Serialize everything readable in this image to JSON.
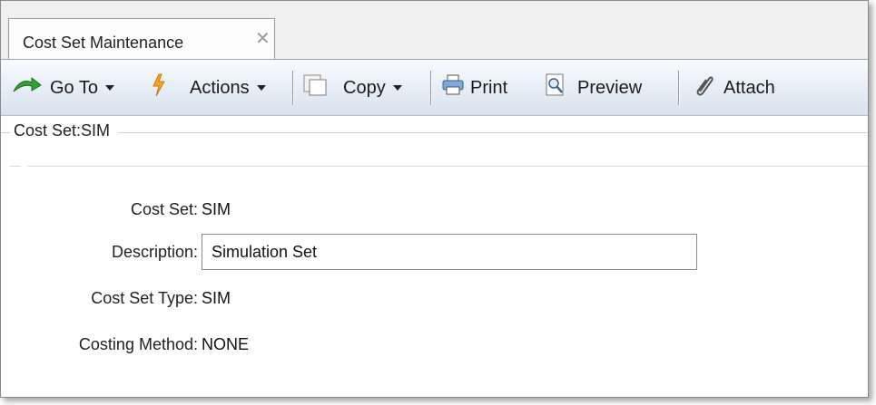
{
  "tab": {
    "title": "Cost Set Maintenance",
    "close_glyph": "✕"
  },
  "toolbar": {
    "goto_label": "Go To",
    "actions_label": "Actions",
    "copy_label": "Copy",
    "print_label": "Print",
    "preview_label": "Preview",
    "attach_label": "Attach",
    "icons": {
      "goto": "green-arrow-icon",
      "actions": "lightning-icon",
      "copy": "copy-icon",
      "print": "printer-icon",
      "preview": "preview-icon",
      "attach": "paperclip-icon"
    }
  },
  "section": {
    "title": "Cost Set:SIM"
  },
  "form": {
    "cost_set_label": "Cost Set:",
    "cost_set_value": "SIM",
    "description_label": "Description:",
    "description_value": "Simulation Set",
    "cost_set_type_label": "Cost Set Type:",
    "cost_set_type_value": "SIM",
    "costing_method_label": "Costing Method:",
    "costing_method_value": "NONE"
  },
  "colors": {
    "toolbar_top": "#fafcff",
    "toolbar_bottom": "#d8e2ee",
    "goto_icon": "#2f9e2f",
    "actions_icon": "#f2a621"
  }
}
